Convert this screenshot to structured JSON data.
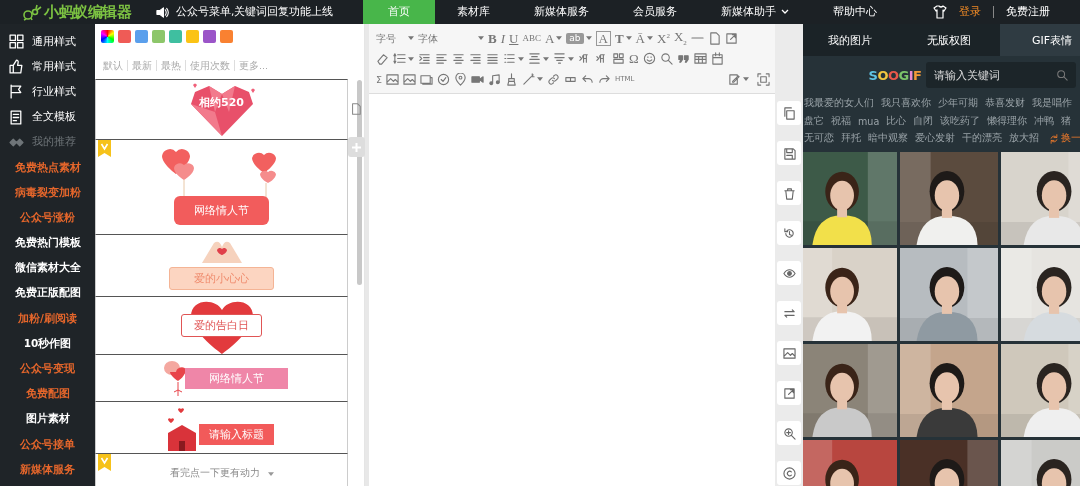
{
  "top_bar": {
    "logo": "小蚂蚁编辑器",
    "notice": "公众号菜单,关键词回复功能上线",
    "nav": [
      {
        "label": "首页",
        "selected": true,
        "dropdown": false
      },
      {
        "label": "素材库",
        "selected": false,
        "dropdown": false
      },
      {
        "label": "新媒体服务",
        "selected": false,
        "dropdown": false
      },
      {
        "label": "会员服务",
        "selected": false,
        "dropdown": false
      },
      {
        "label": "新媒体助手",
        "selected": false,
        "dropdown": true
      },
      {
        "label": "帮助中心",
        "selected": false,
        "dropdown": false
      }
    ],
    "login": "登录",
    "register": "免费注册"
  },
  "sidebar": {
    "items": [
      {
        "kind": "nav",
        "label": "通用样式"
      },
      {
        "kind": "nav",
        "label": "常用样式"
      },
      {
        "kind": "nav",
        "label": "行业样式"
      },
      {
        "kind": "nav",
        "label": "全文模板"
      },
      {
        "kind": "heading",
        "label": "我的推荐"
      },
      {
        "kind": "link",
        "label": "免费热点素材",
        "color": "#e5662b"
      },
      {
        "kind": "link",
        "label": "病毒裂变加粉",
        "color": "#e5662b"
      },
      {
        "kind": "link",
        "label": "公众号涨粉",
        "color": "#e5662b"
      },
      {
        "kind": "link",
        "label": "免费热门模板",
        "color": "#ffffff"
      },
      {
        "kind": "link",
        "label": "微信素材大全",
        "color": "#ffffff"
      },
      {
        "kind": "link",
        "label": "免费正版配图",
        "color": "#ffffff"
      },
      {
        "kind": "link",
        "label": "加粉/刷阅读",
        "color": "#e5662b"
      },
      {
        "kind": "link",
        "label": "10秒作图",
        "color": "#ffffff"
      },
      {
        "kind": "link",
        "label": "公众号变现",
        "color": "#e5662b"
      },
      {
        "kind": "link",
        "label": "免费配图",
        "color": "#e5662b"
      },
      {
        "kind": "link",
        "label": "图片素材",
        "color": "#ffffff"
      },
      {
        "kind": "link",
        "label": "公众号接单",
        "color": "#e5662b"
      },
      {
        "kind": "link",
        "label": "新媒体服务",
        "color": "#e5662b"
      }
    ]
  },
  "style_panel": {
    "swatches": [
      {
        "kind": "rainbow"
      },
      {
        "kind": "solid",
        "color": "#ef5b56"
      },
      {
        "kind": "solid",
        "color": "#5a9fec"
      },
      {
        "kind": "solid",
        "color": "#8dc66a"
      },
      {
        "kind": "solid",
        "color": "#3fbfa0"
      },
      {
        "kind": "solid",
        "color": "#fbc315"
      },
      {
        "kind": "solid",
        "color": "#9b55c8"
      },
      {
        "kind": "solid",
        "color": "#f98131"
      }
    ],
    "filters": [
      "默认",
      "最新",
      "最热",
      "使用次数",
      "更多..."
    ],
    "cards": [
      {
        "kind": "gem-heart",
        "text": "相约520",
        "vip": false
      },
      {
        "kind": "balloon-sign",
        "text": "网络情人节",
        "vip": true
      },
      {
        "kind": "hands-sign",
        "text": "爱的小心心",
        "vip": false
      },
      {
        "kind": "heart-sign",
        "text": "爱的告白日",
        "vip": false
      },
      {
        "kind": "balloon-pink",
        "text": "网络情人节",
        "vip": false
      },
      {
        "kind": "gift-sign",
        "text": "请输入标题",
        "vip": false
      },
      {
        "kind": "text-line",
        "text": "看完点一下更有动力",
        "vip": true
      }
    ]
  },
  "editor": {
    "toolbar": [
      {
        "items": [
          {
            "kind": "text",
            "label": "字号",
            "dropdown": true
          },
          {
            "kind": "wide",
            "label": "字体",
            "dropdown": true
          },
          {
            "kind": "bold",
            "label": "B",
            "dropdown": false
          },
          {
            "kind": "italic",
            "label": "I",
            "dropdown": false
          },
          {
            "kind": "underline",
            "label": "U",
            "dropdown": false
          },
          {
            "kind": "strike",
            "label": "ABC",
            "dropdown": false
          },
          {
            "kind": "text",
            "label": "A",
            "dropdown": true
          },
          {
            "kind": "highlight",
            "label": "ab",
            "dropdown": true
          },
          {
            "kind": "boxed",
            "label": "A",
            "dropdown": false
          },
          {
            "kind": "bold",
            "label": "T",
            "dropdown": true
          },
          {
            "kind": "text",
            "label": "Ā",
            "dropdown": true
          },
          {
            "kind": "text",
            "label": "X$^{2}$",
            "dropdown": false
          },
          {
            "kind": "text",
            "label": "X$_{2}$",
            "dropdown": false
          },
          {
            "kind": "icon",
            "dropdown": false
          },
          {
            "kind": "icon",
            "dropdown": false
          },
          {
            "kind": "icon",
            "dropdown": false
          }
        ]
      },
      {
        "items": [
          {
            "kind": "icon",
            "dropdown": false
          },
          {
            "kind": "icon",
            "dropdown": true
          },
          {
            "kind": "icon",
            "dropdown": false
          },
          {
            "kind": "icon",
            "dropdown": false
          },
          {
            "kind": "icon",
            "dropdown": false
          },
          {
            "kind": "icon",
            "dropdown": false
          },
          {
            "kind": "icon",
            "dropdown": false
          },
          {
            "kind": "icon",
            "dropdown": true
          },
          {
            "kind": "icon",
            "dropdown": true
          },
          {
            "kind": "icon",
            "dropdown": true
          },
          {
            "kind": "icon",
            "dropdown": false
          },
          {
            "kind": "icon",
            "dropdown": false
          },
          {
            "kind": "icon",
            "dropdown": false
          },
          {
            "kind": "text",
            "label": "Ω",
            "dropdown": false
          },
          {
            "kind": "icon",
            "dropdown": false
          },
          {
            "kind": "icon",
            "dropdown": false
          },
          {
            "kind": "icon",
            "dropdown": false
          },
          {
            "kind": "icon",
            "dropdown": false
          },
          {
            "kind": "icon",
            "dropdown": false
          }
        ]
      },
      {
        "items": [
          {
            "kind": "text",
            "label": "Σ",
            "dropdown": false
          },
          {
            "kind": "icon",
            "dropdown": false
          },
          {
            "kind": "icon",
            "dropdown": false
          },
          {
            "kind": "icon",
            "dropdown": false
          },
          {
            "kind": "icon",
            "dropdown": false
          },
          {
            "kind": "icon",
            "dropdown": false
          },
          {
            "kind": "icon",
            "dropdown": false
          },
          {
            "kind": "icon",
            "dropdown": false
          },
          {
            "kind": "icon",
            "dropdown": false
          },
          {
            "kind": "icon",
            "dropdown": true
          },
          {
            "kind": "icon",
            "dropdown": false
          },
          {
            "kind": "icon",
            "dropdown": false
          },
          {
            "kind": "icon",
            "dropdown": false
          },
          {
            "kind": "icon",
            "dropdown": false
          },
          {
            "kind": "small",
            "label": "HTML",
            "dropdown": false
          }
        ],
        "end_items": [
          {
            "kind": "icon",
            "dropdown": true
          },
          {
            "kind": "icon",
            "dropdown": false
          }
        ]
      }
    ]
  },
  "image_panel": {
    "tabs": [
      {
        "label": "我的图片",
        "selected": false
      },
      {
        "label": "无版权图",
        "selected": false
      },
      {
        "label": "GIF表情",
        "selected": true
      }
    ],
    "logo": "SOOGIF",
    "search": {
      "placeholder": "请输入关键词"
    },
    "tags": [
      [
        "我最爱的女人们",
        "我只喜欢你",
        "少年可期",
        "恭喜发财",
        "我是唱作"
      ],
      [
        "盘它",
        "祝福",
        "mua",
        "比心",
        "自闭",
        "该吃药了",
        "懒得理你",
        "冲鸭",
        "猪"
      ],
      [
        "无可恋",
        "拜托",
        "暗中观察",
        "爱心发射",
        "干的漂亮",
        "放大招"
      ]
    ],
    "refresh": "换一",
    "gifs": [
      {
        "kind": "picture"
      },
      {
        "kind": "picture"
      },
      {
        "kind": "picture"
      },
      {
        "kind": "picture"
      },
      {
        "kind": "picture"
      },
      {
        "kind": "picture"
      },
      {
        "kind": "picture"
      },
      {
        "kind": "picture"
      },
      {
        "kind": "picture"
      },
      {
        "kind": "picture"
      },
      {
        "kind": "picture"
      },
      {
        "kind": "picture"
      }
    ]
  }
}
